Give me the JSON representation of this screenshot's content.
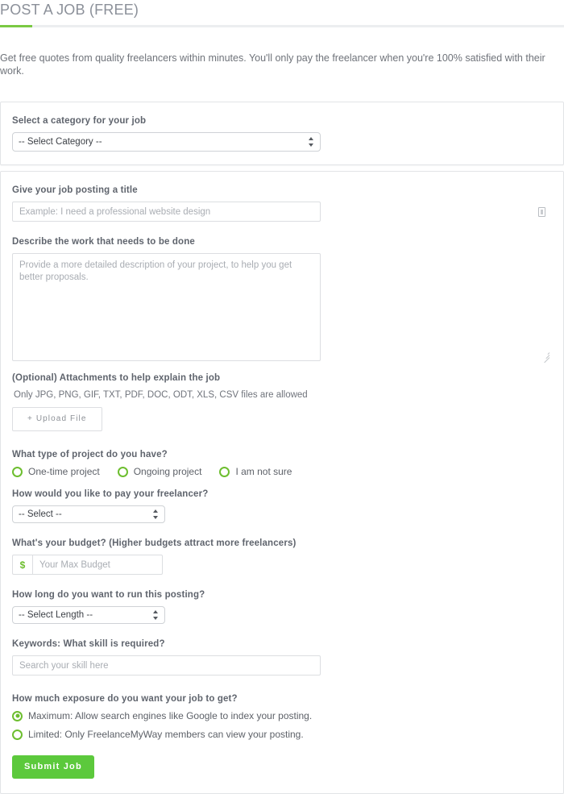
{
  "header": {
    "title": "POST A JOB (FREE)",
    "accent_color": "#7ac943",
    "intro": "Get free quotes from quality freelancers within minutes. You'll only pay the freelancer when you're 100% satisfied with their work."
  },
  "category_card": {
    "label": "Select a category for your job",
    "select_value": "-- Select Category --"
  },
  "details_card": {
    "title_label": "Give your job posting a title",
    "title_placeholder": "Example: I need a professional website design",
    "describe_label": "Describe the work that needs to be done",
    "describe_placeholder": "Provide a more detailed description of your project, to help you get better proposals.",
    "attachments_label": "(Optional) Attachments to help explain the job",
    "attachments_hint": "Only JPG, PNG, GIF, TXT, PDF, DOC, ODT, XLS, CSV files are allowed",
    "upload_button": "+ Upload File",
    "project_type_label": "What type of project do you have?",
    "project_type_options": [
      {
        "label": "One-time project",
        "checked": false
      },
      {
        "label": "Ongoing project",
        "checked": false
      },
      {
        "label": "I am not sure",
        "checked": false
      }
    ],
    "pay_label": "How would you like to pay your freelancer?",
    "pay_select_value": "-- Select --",
    "budget_label": "What's your budget? (Higher budgets attract more freelancers)",
    "budget_prefix": "$",
    "budget_placeholder": "Your Max Budget",
    "length_label": "How long do you want to run this posting?",
    "length_select_value": "-- Select Length --",
    "keywords_label": "Keywords: What skill is required?",
    "keywords_placeholder": "Search your skill here",
    "exposure_label": "How much exposure do you want your job to get?",
    "exposure_options": [
      {
        "label": "Maximum: Allow search engines like Google to index your posting.",
        "checked": true
      },
      {
        "label": "Limited: Only FreelanceMyWay members can view your posting.",
        "checked": false
      }
    ],
    "submit_button": "Submit Job"
  }
}
